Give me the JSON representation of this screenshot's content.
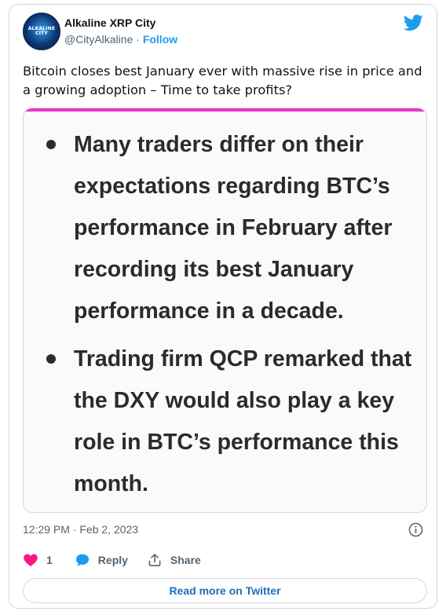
{
  "author": {
    "avatar_text": "ALKALINE CITY",
    "name": "Alkaline XRP City",
    "handle": "@CityAlkaline",
    "separator": "·",
    "follow_label": "Follow"
  },
  "tweet": {
    "text": "Bitcoin closes best January ever with massive rise in price and a growing adoption – Time to take profits?",
    "media_bullets": [
      "Many traders differ on their expectations regarding BTC’s performance in February after recording its best January performance in a decade.",
      "Trading firm QCP remarked that the DXY would also play a key role in BTC’s performance this month."
    ],
    "timestamp": "12:29 PM · Feb 2, 2023"
  },
  "actions": {
    "like_count": "1",
    "reply_label": "Reply",
    "share_label": "Share"
  },
  "read_more_label": "Read more on Twitter",
  "watermark": "",
  "icons": [
    "twitter-bird-icon",
    "info-icon",
    "heart-icon",
    "reply-bubble-icon",
    "share-icon"
  ],
  "colors": {
    "accent": "#1d9bf0",
    "heart": "#f91880",
    "media_topbar": "#e536c8",
    "secondary_text": "#536471",
    "border": "#cfd9de"
  }
}
